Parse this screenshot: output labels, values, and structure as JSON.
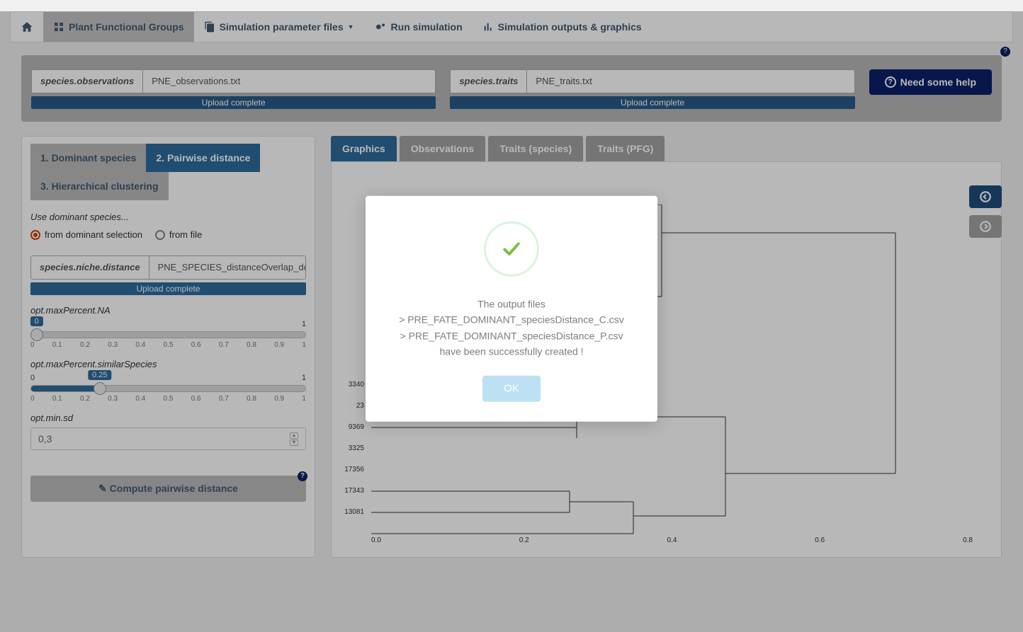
{
  "nav": {
    "items": [
      {
        "label": ""
      },
      {
        "label": "Plant Functional Groups"
      },
      {
        "label": "Simulation parameter files"
      },
      {
        "label": "Run simulation"
      },
      {
        "label": "Simulation outputs & graphics"
      }
    ]
  },
  "upload": {
    "obs_label": "species.observations",
    "obs_value": "PNE_observations.txt",
    "traits_label": "species.traits",
    "traits_value": "PNE_traits.txt",
    "complete": "Upload complete",
    "help": "Need some help"
  },
  "steps": {
    "t1": "1. Dominant species",
    "t2": "2. Pairwise distance",
    "t3": "3. Hierarchical clustering"
  },
  "form": {
    "use_dominant": "Use dominant species...",
    "r1": "from dominant selection",
    "r2": "from file",
    "niche_label": "species.niche.distance",
    "niche_value": "PNE_SPECIES_distanceOverlap_dominan",
    "upload_complete": "Upload complete",
    "s1_title": "opt.maxPercent.NA",
    "s1_min": "0",
    "s1_max": "1",
    "s1_val": "0",
    "s2_title": "opt.maxPercent.similarSpecies",
    "s2_min": "0",
    "s2_max": "1",
    "s2_val": "0.25",
    "sd_title": "opt.min.sd",
    "sd_val": "0,3",
    "compute": "Compute pairwise distance",
    "ticks": [
      "0",
      "0.1",
      "0.2",
      "0.3",
      "0.4",
      "0.5",
      "0.6",
      "0.7",
      "0.8",
      "0.9",
      "1"
    ]
  },
  "rtabs": {
    "t1": "Graphics",
    "t2": "Observations",
    "t3": "Traits (species)",
    "t4": "Traits (PFG)"
  },
  "chart_data": {
    "type": "dendrogram",
    "xlabel": "",
    "ylabel": "",
    "x_ticks": [
      "0.0",
      "0.2",
      "0.4",
      "0.6",
      "0.8"
    ],
    "leaf_labels": [
      "3340",
      "23",
      "9369",
      "3325",
      "17356",
      "17343",
      "13081"
    ],
    "note": "Hierarchical clustering dendrogram; first row of labels not visible (occluded by modal)."
  },
  "modal": {
    "l1": "The output files",
    "l2": "> PRE_FATE_DOMINANT_speciesDistance_C.csv",
    "l3": "> PRE_FATE_DOMINANT_speciesDistance_P.csv",
    "l4": "have been successfully created !",
    "ok": "OK"
  }
}
